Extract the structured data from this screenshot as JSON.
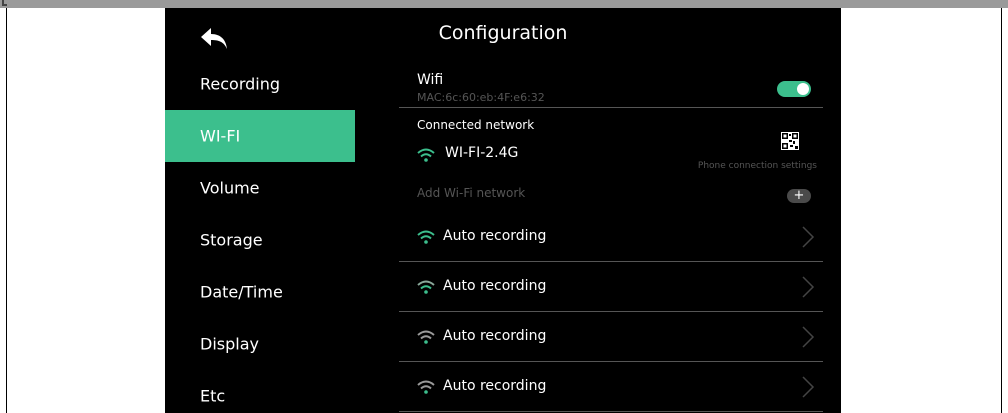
{
  "header": {
    "title": "Configuration"
  },
  "sidebar": {
    "items": [
      {
        "label": "Recording"
      },
      {
        "label": "WI-FI",
        "active": true
      },
      {
        "label": "Volume"
      },
      {
        "label": "Storage"
      },
      {
        "label": "Date/Time"
      },
      {
        "label": "Display"
      },
      {
        "label": "Etc"
      }
    ]
  },
  "wifi": {
    "title": "Wifi",
    "mac": "MAC:6c:60:eb:4F:e6:32",
    "enabled": true
  },
  "connected": {
    "label": "Connected network",
    "network_name": "WI-FI-2.4G",
    "phone_settings_label": "Phone connection settings"
  },
  "add_network": {
    "label": "Add Wi-Fi network",
    "button": "+"
  },
  "networks": [
    {
      "name": "Auto recording",
      "signal_color": "#3cbf8d"
    },
    {
      "name": "Auto recording",
      "signal_color": "#8aa89a"
    },
    {
      "name": "Auto recording",
      "signal_color": "#9a9a9a"
    },
    {
      "name": "Auto recording",
      "signal_color": "#9a9a9a"
    }
  ],
  "colors": {
    "accent": "#3cbf8d",
    "background": "#000000",
    "divider": "#555555"
  },
  "icons": {
    "back": "back-arrow-icon",
    "wifi": "wifi-icon",
    "qr": "qr-code-icon",
    "chevron": "chevron-right-icon",
    "add": "plus-icon"
  }
}
